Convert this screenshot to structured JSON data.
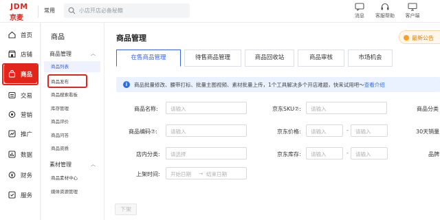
{
  "brand": {
    "logo_top": "JDM",
    "logo_bottom": "京麦"
  },
  "topbar": {
    "common_label": "常用",
    "search_placeholder": "小店开店必备秘籍",
    "items": [
      {
        "label": "消息",
        "icon": "message-icon"
      },
      {
        "label": "客服帮助",
        "icon": "headset-icon"
      },
      {
        "label": "客户端",
        "icon": "monitor-icon"
      }
    ]
  },
  "leftnav": {
    "items": [
      {
        "label": "首页",
        "icon": "home-icon"
      },
      {
        "label": "店铺",
        "icon": "shop-icon"
      },
      {
        "label": "商品",
        "icon": "bag-icon",
        "active": true
      },
      {
        "label": "交易",
        "icon": "trade-icon"
      },
      {
        "label": "营销",
        "icon": "marketing-icon"
      },
      {
        "label": "推广",
        "icon": "promotion-icon"
      },
      {
        "label": "数据",
        "icon": "data-icon"
      },
      {
        "label": "财务",
        "icon": "finance-icon"
      },
      {
        "label": "服务",
        "icon": "service-icon"
      }
    ]
  },
  "submenu": {
    "title": "商品",
    "groups": [
      {
        "label": "商品管理",
        "items": [
          "商品列表",
          "商品发布",
          "商品搜索看板",
          "库存管理",
          "商品评价",
          "商品问答",
          "商品资质"
        ]
      },
      {
        "label": "素材管理",
        "items": [
          "商品素材中心",
          "媒体资源管理"
        ]
      }
    ]
  },
  "main": {
    "title": "商品管理",
    "announcement": "最新公告",
    "tabs": [
      "在售商品管理",
      "待售商品管理",
      "商品回收站",
      "商品审核",
      "市场机会"
    ],
    "info": {
      "text": "商品批量修改、腰带打标、批量主图视频、素材批量上传，1个工具解决多个开店难题，快来试用吧～",
      "link": "查看介绍"
    },
    "filters": {
      "name_label": "商品名称:",
      "code_label": "商品编码⑦:",
      "category_label": "店内分类:",
      "listing_time_label": "上架时间:",
      "sku_label": "京东SKU⑦:",
      "price_label": "京东价格:",
      "stock_label": "京东库存:",
      "right_label_1": "商品分类",
      "right_label_2": "30天销量",
      "right_label_3": "品牌",
      "input_placeholder": "请输入",
      "select_placeholder": "请选择",
      "start_date": "开始日期",
      "arrow": "→",
      "end_date": "结束日期",
      "range_sep": "-"
    },
    "down_button": "下架"
  }
}
